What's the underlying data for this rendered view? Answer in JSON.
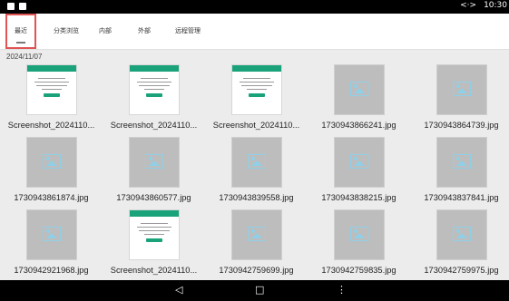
{
  "status_bar": {
    "time": "10:30",
    "arrows_icon": "arrows-icon"
  },
  "tabs": [
    {
      "label": "最近",
      "selected": true
    },
    {
      "label": "分类浏览",
      "selected": false
    },
    {
      "label": "内部",
      "selected": false
    },
    {
      "label": "外部",
      "selected": false
    },
    {
      "label": "远程管理",
      "selected": false
    }
  ],
  "section_date": "2024/11/07",
  "files": [
    {
      "name": "Screenshot_2024110...",
      "kind": "screenshot"
    },
    {
      "name": "Screenshot_2024110...",
      "kind": "screenshot"
    },
    {
      "name": "Screenshot_2024110...",
      "kind": "screenshot"
    },
    {
      "name": "1730943866241.jpg",
      "kind": "image"
    },
    {
      "name": "1730943864739.jpg",
      "kind": "image"
    },
    {
      "name": "1730943861874.jpg",
      "kind": "image"
    },
    {
      "name": "1730943860577.jpg",
      "kind": "image"
    },
    {
      "name": "1730943839558.jpg",
      "kind": "image"
    },
    {
      "name": "1730943838215.jpg",
      "kind": "image"
    },
    {
      "name": "1730943837841.jpg",
      "kind": "image"
    },
    {
      "name": "1730942921968.jpg",
      "kind": "image"
    },
    {
      "name": "Screenshot_2024110...",
      "kind": "screenshot"
    },
    {
      "name": "1730942759699.jpg",
      "kind": "image"
    },
    {
      "name": "1730942759835.jpg",
      "kind": "image"
    },
    {
      "name": "1730942759975.jpg",
      "kind": "image"
    }
  ],
  "nav_bar": {
    "back": "◁",
    "home": "□",
    "recents": "⋮"
  },
  "colors": {
    "accent": "#1aa37a",
    "selection_outline": "#e05454",
    "placeholder": "#bdbdbd"
  }
}
